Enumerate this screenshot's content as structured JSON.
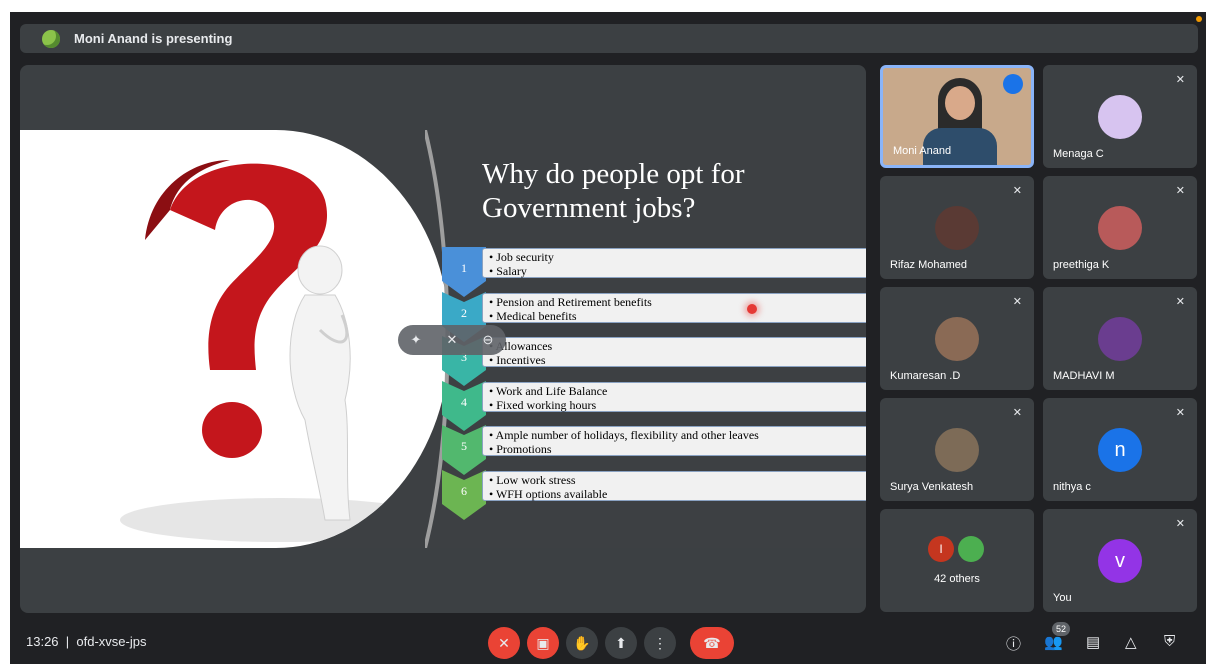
{
  "presenter_bar": {
    "text": "Moni Anand is presenting"
  },
  "slide": {
    "title": "Why do people opt for Government jobs?",
    "rows": [
      {
        "num": "1",
        "color": "#4a90d9",
        "items": [
          "Job security",
          "Salary"
        ]
      },
      {
        "num": "2",
        "color": "#3aa9c7",
        "items": [
          "Pension and Retirement benefits",
          "Medical benefits"
        ]
      },
      {
        "num": "3",
        "color": "#39b5a6",
        "items": [
          "Allowances",
          "Incentives"
        ]
      },
      {
        "num": "4",
        "color": "#3fb98b",
        "items": [
          "Work and Life Balance",
          "Fixed working hours"
        ]
      },
      {
        "num": "5",
        "color": "#52b86e",
        "items": [
          "Ample number of holidays, flexibility and other leaves",
          "Promotions"
        ]
      },
      {
        "num": "6",
        "color": "#6cb552",
        "items": [
          "Low work stress",
          "WFH options available"
        ]
      }
    ]
  },
  "participants": [
    {
      "name": "Moni Anand",
      "active": true
    },
    {
      "name": "Menaga C",
      "muted": true
    },
    {
      "name": "Rifaz Mohamed",
      "muted": true
    },
    {
      "name": "preethiga K",
      "muted": true
    },
    {
      "name": "Kumaresan .D",
      "muted": true
    },
    {
      "name": "MADHAVI M",
      "muted": true
    },
    {
      "name": "Surya Venkatesh",
      "muted": true
    },
    {
      "name": "nithya c",
      "muted": true,
      "letter": "n",
      "color": "#1a73e8"
    },
    {
      "name": "42 others",
      "others_initial": "I"
    },
    {
      "name": "You",
      "muted": true,
      "letter": "v",
      "color": "#9334e6"
    }
  ],
  "bottom": {
    "time": "13:26",
    "meeting_code": "ofd-xvse-jps",
    "people_count": "52"
  },
  "icons": {
    "mic_off": "mic-off-icon",
    "cam_off": "camera-off-icon",
    "hand": "raise-hand-icon",
    "present": "present-icon",
    "more": "more-options-icon",
    "end": "end-call-icon",
    "info": "info-icon",
    "people": "people-icon",
    "chat": "chat-icon",
    "activities": "activities-icon",
    "host": "host-controls-icon"
  }
}
